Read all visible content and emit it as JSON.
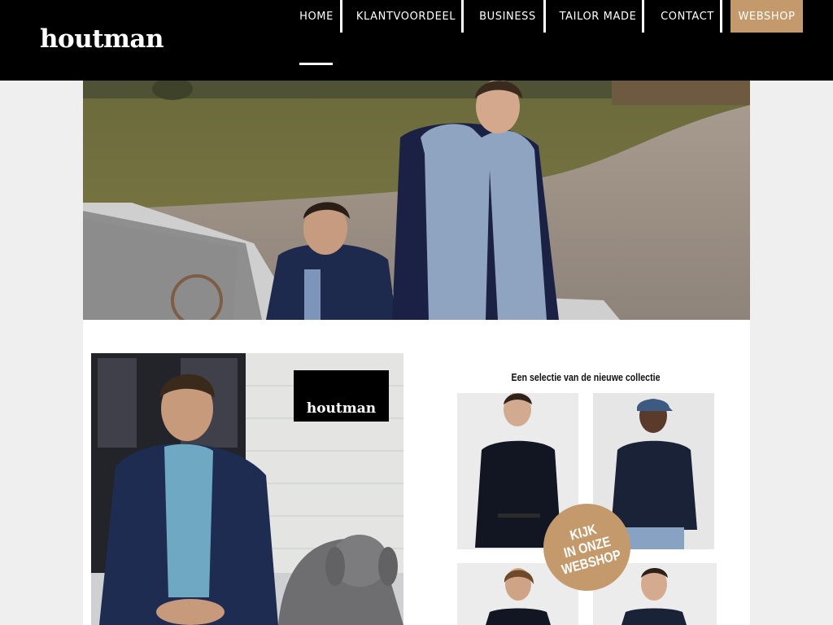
{
  "brand": {
    "logo_text": "houtman",
    "accent_color": "#c49a6c"
  },
  "nav": {
    "items": [
      {
        "label": "HOME",
        "active": true
      },
      {
        "label": "KLANTVOORDEEL"
      },
      {
        "label": "BUSINESS"
      },
      {
        "label": "TAILOR MADE"
      },
      {
        "label": "CONTACT"
      },
      {
        "label": "WEBSHOP",
        "highlighted": true
      }
    ]
  },
  "hero": {
    "image": "two men in navy and blue puffer jackets next to a classic convertible car"
  },
  "promo_left": {
    "logo_text": "houtman"
  },
  "promo_right": {
    "title": "Een selectie van de nieuwe collectie",
    "stamp_text": "KIJK\nIN ONZE\nWEBSHOP"
  }
}
